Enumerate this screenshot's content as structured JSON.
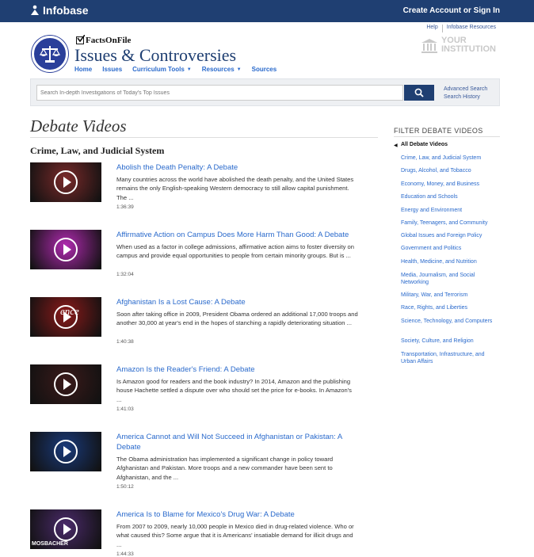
{
  "topbar": {
    "logo_text": "Infobase",
    "account_link": "Create Account or Sign In"
  },
  "util_links": [
    "Help",
    "Infobase Resources"
  ],
  "brand": {
    "publisher": "FactsOnFile",
    "title": "Issues & Controversies"
  },
  "institution": {
    "line1": "YOUR",
    "line2": "INSTITUTION"
  },
  "nav": [
    {
      "label": "Home",
      "dropdown": false
    },
    {
      "label": "Issues",
      "dropdown": false
    },
    {
      "label": "Curriculum Tools",
      "dropdown": true
    },
    {
      "label": "Resources",
      "dropdown": true
    },
    {
      "label": "Sources",
      "dropdown": false
    }
  ],
  "search": {
    "placeholder": "Search In-depth Investigations of Today's Top Issues",
    "advanced": "Advanced Search",
    "history": "Search History"
  },
  "page_title": "Debate Videos",
  "section_title": "Crime, Law, and Judicial System",
  "videos": [
    {
      "title": "Abolish the Death Penalty: A Debate",
      "description": "Many countries across the world have abolished the death penalty, and the United States remains the only English-speaking Western democracy to still allow capital punishment. The ...",
      "duration": "1:36:39",
      "thumb_color": "#7a2a2a"
    },
    {
      "title": "Affirmative Action on Campus Does More Harm Than Good: A Debate",
      "description": "When used as a factor in college admissions, affirmative action aims to foster diversity on campus and provide equal opportunities to people from certain minority groups. But is ...",
      "duration": "1:32:04",
      "thumb_color": "#b02ab0"
    },
    {
      "title": "Afghanistan Is a Lost Cause: A Debate",
      "description": "Soon after taking office in 2009, President Obama ordered an additional 17,000 troops and another 30,000 at year's end in the hopes of stanching a rapidly deteriorating situation ...",
      "duration": "1:40:38",
      "thumb_color": "#8a1a1a",
      "thumb_text": "ence"
    },
    {
      "title": "Amazon Is the Reader's Friend: A Debate",
      "description": "Is Amazon good for readers and the book industry? In 2014, Amazon and the publishing house Hachette settled a dispute over who should set the price for e-books. In Amazon's ...",
      "duration": "1:41:03",
      "thumb_color": "#3a1a1a"
    },
    {
      "title": "America Cannot and Will Not Succeed in Afghanistan or Pakistan: A Debate",
      "description": "The Obama administration has implemented a significant change in policy toward Afghanistan and Pakistan. More troops and a new commander have been sent to Afghanistan, and the ...",
      "duration": "1:50:12",
      "thumb_color": "#1a3a7a"
    },
    {
      "title": "America Is to Blame for Mexico's Drug War: A Debate",
      "description": "From 2007 to 2009, nearly 10,000 people in Mexico died in drug-related violence. Who or what caused this? Some argue that it is Americans' insatiable demand for illicit drugs and ...",
      "duration": "1:44:33",
      "thumb_color": "#4a2a6a",
      "thumb_text": "MOSBACHER"
    }
  ],
  "filter": {
    "title": "FILTER DEBATE VIDEOS",
    "items": [
      {
        "label": "All Debate Videos",
        "active": true
      },
      {
        "label": "Crime, Law, and Judicial System"
      },
      {
        "label": "Drugs, Alcohol, and Tobacco"
      },
      {
        "label": "Economy, Money, and Business"
      },
      {
        "label": "Education and Schools"
      },
      {
        "label": "Energy and Environment"
      },
      {
        "label": "Family, Teenagers, and Community"
      },
      {
        "label": "Global Issues and Foreign Policy"
      },
      {
        "label": "Government and Politics"
      },
      {
        "label": "Health, Medicine, and Nutrition"
      },
      {
        "label": "Media, Journalism, and Social Networking"
      },
      {
        "label": "Military, War, and Terrorism"
      },
      {
        "label": "Race, Rights, and Liberties"
      },
      {
        "label": "Science, Technology, and Computers"
      },
      {
        "label": "Society, Culture, and Religion"
      },
      {
        "label": "Transportation, Infrastructure, and Urban Affairs"
      }
    ]
  }
}
